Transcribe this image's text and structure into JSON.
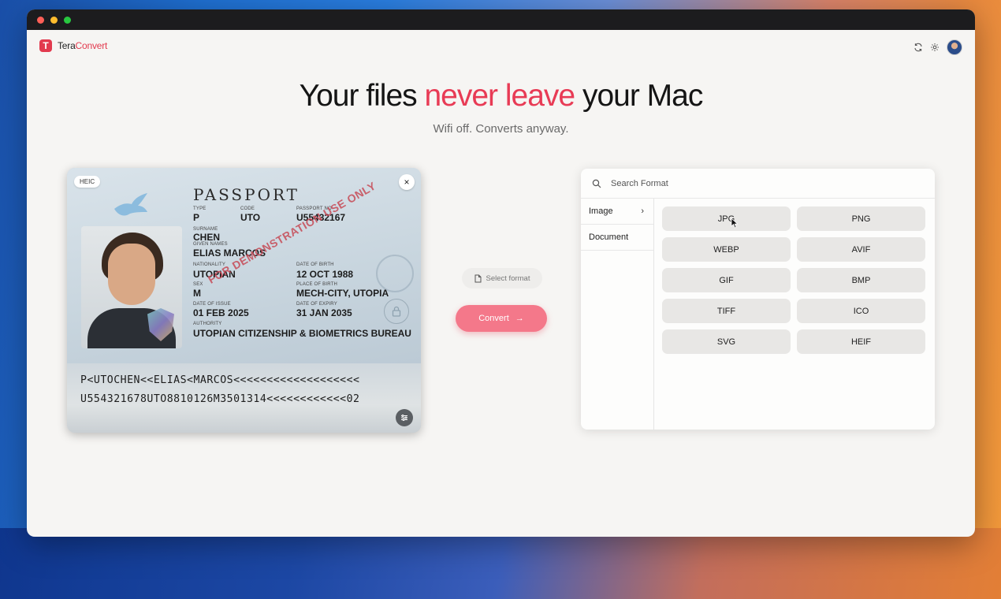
{
  "app": {
    "name_prefix": "Tera",
    "name_accent": "Convert",
    "logo_letter": "T"
  },
  "header": {
    "title_before": "Your files ",
    "title_accent": "never leave",
    "title_after": " your Mac",
    "subtitle": "Wifi off. Converts anyway."
  },
  "toolbar": {
    "icons": [
      "refresh-icon",
      "gear-icon",
      "avatar"
    ]
  },
  "preview": {
    "format_badge": "HEIC",
    "close_label": "×",
    "passport": {
      "heading": "PASSPORT",
      "type_label": "TYPE",
      "type_value": "P",
      "code_label": "CODE",
      "code_value": "UTO",
      "number_label": "PASSPORT NO",
      "number_value": "U55432167",
      "surname_label": "SURNAME",
      "surname_value": "CHEN",
      "given_label": "GIVEN NAMES",
      "given_value": "ELIAS MARCOS",
      "nationality_label": "NATIONALITY",
      "nationality_value": "UTOPIAN",
      "dob_label": "DATE OF BIRTH",
      "dob_value": "12 OCT 1988",
      "sex_label": "SEX",
      "sex_value": "M",
      "pob_label": "PLACE OF BIRTH",
      "pob_value": "MECH-CITY, UTOPIA",
      "issue_label": "DATE OF ISSUE",
      "issue_value": "01 FEB 2025",
      "expiry_label": "DATE OF EXPIRY",
      "expiry_value": "31 JAN 2035",
      "authority_label": "AUTHORITY",
      "authority_value": "UTOPIAN CITIZENSHIP & BIOMETRICS BUREAU",
      "stamp": "FOR DEMONSTRATION USE ONLY",
      "mrz_line1": "P<UTOCHEN<<ELIAS<MARCOS<<<<<<<<<<<<<<<<<<<",
      "mrz_line2": "U554321678UTO8810126M3501314<<<<<<<<<<<<02"
    }
  },
  "controls": {
    "select_format_label": "Select format",
    "convert_label": "Convert",
    "convert_arrow": "→"
  },
  "format_panel": {
    "search_placeholder": "Search Format",
    "categories": [
      {
        "label": "Image",
        "chevron": "›"
      },
      {
        "label": "Document",
        "chevron": ""
      }
    ],
    "formats": [
      "JPG",
      "PNG",
      "WEBP",
      "AVIF",
      "GIF",
      "BMP",
      "TIFF",
      "ICO",
      "SVG",
      "HEIF"
    ]
  },
  "colors": {
    "accent": "#e83b55",
    "convert_button": "#f4788a"
  }
}
